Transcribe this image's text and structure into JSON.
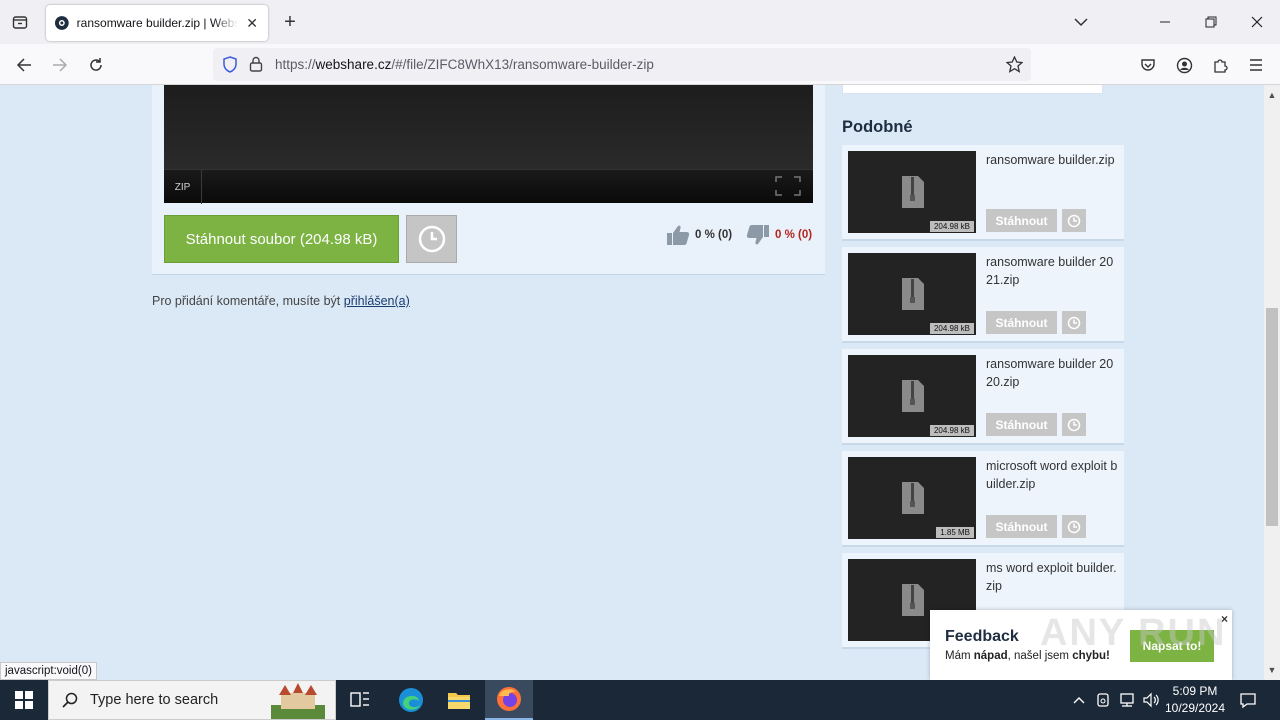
{
  "browser": {
    "tab_title": "ransomware builder.zip | Webshare",
    "url_prefix": "https://",
    "url_host": "webshare.cz",
    "url_path": "/#/file/ZIFC8WhX13/ransomware-builder-zip",
    "status_tip": "javascript:void(0)"
  },
  "viewer": {
    "type_label": "ZIP"
  },
  "actions": {
    "download_label": "Stáhnout soubor (204.98 kB)",
    "vote_up": "0 % (0)",
    "vote_down": "0 % (0)"
  },
  "comments": {
    "note": "Pro přidání komentáře, musíte být ",
    "login_link": "přihlášen(a)"
  },
  "similar": {
    "heading": "Podobné",
    "download_label": "Stáhnout",
    "items": [
      {
        "name": "ransomware builder.zip",
        "size": "204.98 kB"
      },
      {
        "name": "ransomware builder 2021.zip",
        "size": "204.98 kB"
      },
      {
        "name": "ransomware builder 2020.zip",
        "size": "204.98 kB"
      },
      {
        "name": "microsoft word exploit builder.zip",
        "size": "1.85 MB"
      },
      {
        "name": "ms word exploit builder.zip",
        "size": ""
      }
    ]
  },
  "feedback": {
    "title": "Feedback",
    "text_1": "Mám ",
    "text_2": "nápad",
    "text_3": ", našel jsem ",
    "text_4": "chybu!",
    "button": "Napsat to!",
    "close": "×"
  },
  "watermark": "ANY RUN",
  "taskbar": {
    "search_placeholder": "Type here to search",
    "time": "5:09 PM",
    "date": "10/29/2024"
  },
  "colors": {
    "page_bg": "#dbe9f7",
    "download_green": "#7cb342",
    "vote_down_red": "#b3261e"
  }
}
